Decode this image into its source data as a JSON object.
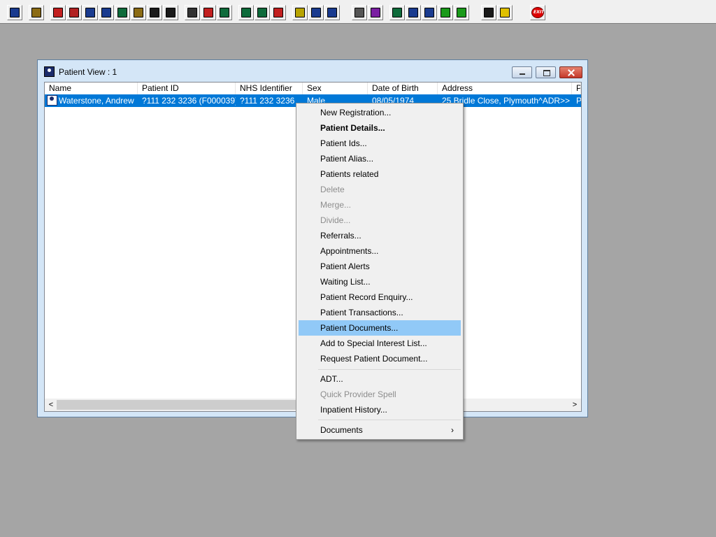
{
  "toolbar": {
    "buttons": [
      {
        "name": "patient-icon",
        "color": "#1a3b8f"
      },
      {
        "name": "print-icon",
        "color": "#8b6b14"
      },
      {
        "name": "book-icon",
        "color": "#c21f1f"
      },
      {
        "name": "edit-document-icon",
        "color": "#b22222"
      },
      {
        "name": "search-records-icon",
        "color": "#1a3b8f"
      },
      {
        "name": "mail-icon",
        "color": "#1a3b8f"
      },
      {
        "name": "person-card-icon",
        "color": "#0e6b3b"
      },
      {
        "name": "form-edit-icon",
        "color": "#8b6b14"
      },
      {
        "name": "scan-icon",
        "color": "#1a1a1a"
      },
      {
        "name": "transfer-icon",
        "color": "#1a1a1a"
      },
      {
        "name": "cancel-document-icon",
        "color": "#333333"
      },
      {
        "name": "clock-icon",
        "color": "#c21f1f"
      },
      {
        "name": "list-window-icon",
        "color": "#0e6b3b"
      },
      {
        "name": "notes-icon",
        "color": "#0e6b3b"
      },
      {
        "name": "report-icon",
        "color": "#0e6b3b"
      },
      {
        "name": "refresh-icon",
        "color": "#c21f1f"
      },
      {
        "name": "letter-icon",
        "color": "#b8a400"
      },
      {
        "name": "ambulance-icon",
        "color": "#1a3b8f"
      },
      {
        "name": "bed-icon",
        "color": "#1a3b8f"
      },
      {
        "name": "blank-document-icon",
        "color": "#555555"
      },
      {
        "name": "bar-chart-icon",
        "color": "#7a1fa2"
      },
      {
        "name": "globe-icon",
        "color": "#0e6b3b"
      },
      {
        "name": "inbox-icon",
        "color": "#1a3b8f"
      },
      {
        "name": "download-tray-icon",
        "color": "#1a3b8f"
      },
      {
        "name": "green-check-icon",
        "color": "#1a9a1a"
      },
      {
        "name": "sync-icon",
        "color": "#1a9a1a"
      },
      {
        "name": "swap-icon",
        "color": "#1a1a1a"
      },
      {
        "name": "warning-icon",
        "color": "#e0c000"
      },
      {
        "name": "exit-icon",
        "color": "#d00000"
      }
    ]
  },
  "window": {
    "title": "Patient View : 1",
    "columns": [
      "Name",
      "Patient ID",
      "NHS Identifier",
      "Sex",
      "Date of Birth",
      "Address",
      "P"
    ],
    "rows": [
      {
        "name": "Waterstone, Andrew",
        "patient_id": "?111 232 3236 (F000039)",
        "nhs_identifier": "?111 232 3236",
        "sex": "Male",
        "dob": "08/05/1974",
        "address": "25 Bridle Close, Plymouth^ADR>>",
        "extra": "P"
      }
    ]
  },
  "menu": {
    "items": [
      {
        "label": "New Registration...",
        "state": "normal"
      },
      {
        "label": "Patient Details...",
        "state": "bold"
      },
      {
        "label": "Patient Ids...",
        "state": "normal"
      },
      {
        "label": "Patient Alias...",
        "state": "normal"
      },
      {
        "label": "Patients related",
        "state": "normal"
      },
      {
        "label": "Delete",
        "state": "disabled"
      },
      {
        "label": "Merge...",
        "state": "disabled"
      },
      {
        "label": "Divide...",
        "state": "disabled"
      },
      {
        "label": "Referrals...",
        "state": "normal"
      },
      {
        "label": "Appointments...",
        "state": "normal"
      },
      {
        "label": "Patient Alerts",
        "state": "normal"
      },
      {
        "label": "Waiting List...",
        "state": "normal"
      },
      {
        "label": "Patient Record Enquiry...",
        "state": "normal"
      },
      {
        "label": "Patient Transactions...",
        "state": "normal"
      },
      {
        "label": "Patient Documents...",
        "state": "hover"
      },
      {
        "label": "Add to Special Interest List...",
        "state": "normal"
      },
      {
        "label": "Request Patient Document...",
        "state": "normal"
      },
      {
        "label": "ADT...",
        "state": "normal"
      },
      {
        "label": "Quick Provider Spell",
        "state": "disabled"
      },
      {
        "label": "Inpatient History...",
        "state": "normal"
      },
      {
        "label": "Documents",
        "state": "submenu"
      }
    ],
    "submenu_arrow": "›"
  }
}
